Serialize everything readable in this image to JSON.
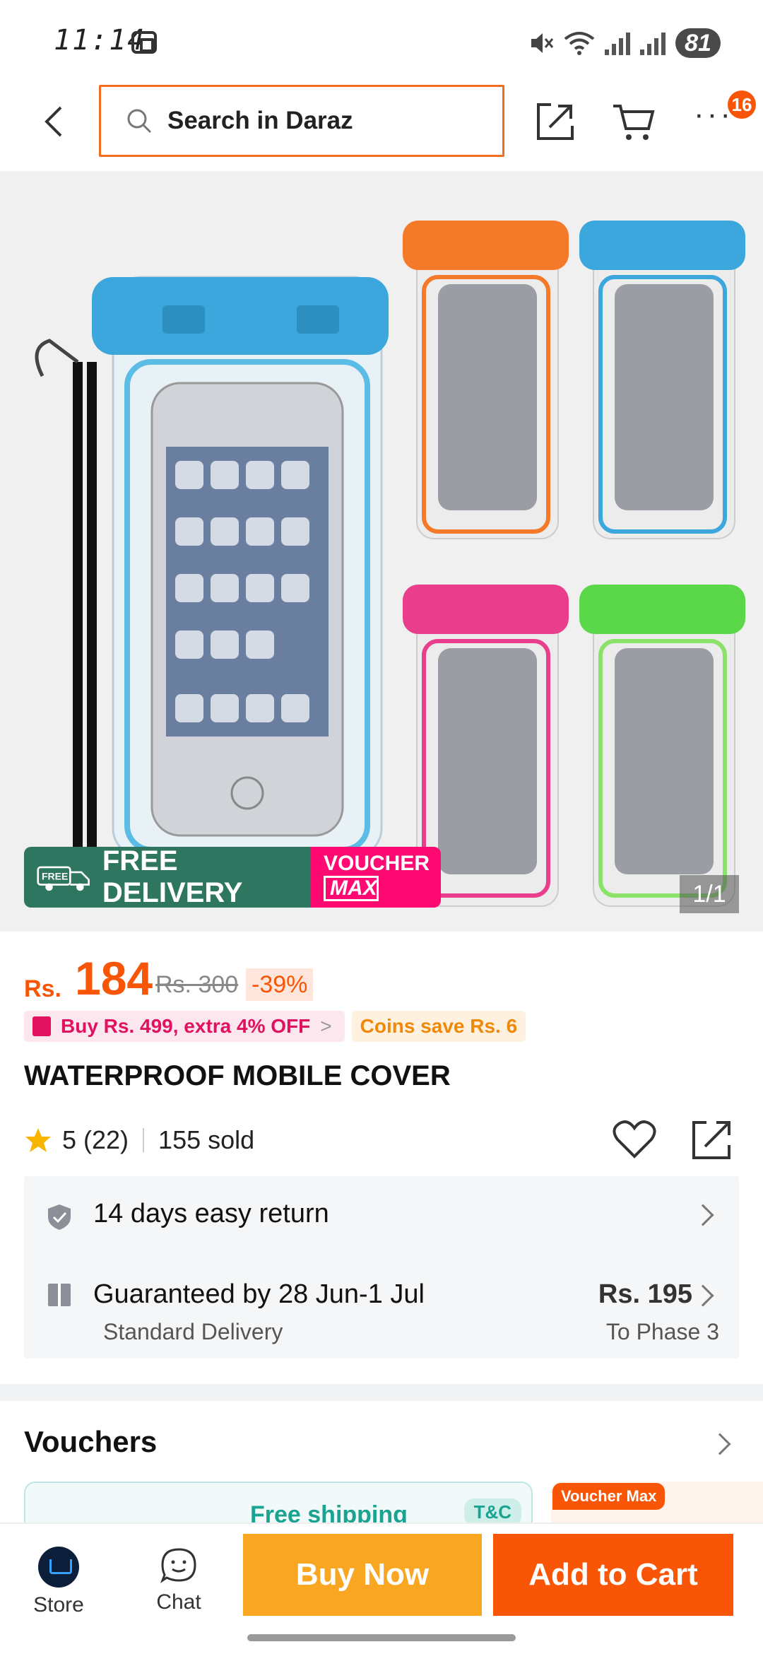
{
  "status_bar": {
    "time": "11:14",
    "battery": "81"
  },
  "header": {
    "search_placeholder": "Search in Daraz",
    "notification_count": "16"
  },
  "gallery": {
    "promo_free_delivery": "FREE DELIVERY",
    "promo_free_badge": "FREE",
    "promo_voucher": "VOUCHER",
    "promo_max": "MAX",
    "counter": "1/1"
  },
  "product": {
    "currency": "Rs.",
    "price": "184",
    "original_price": "Rs. 300",
    "discount": "-39%",
    "promo_deal": "Buy Rs. 499, extra 4% OFF",
    "coins": "Coins save Rs. 6",
    "title": "WATERPROOF MOBILE COVER",
    "rating": "5 (22)",
    "sold": "155 sold"
  },
  "service": {
    "return_text": "14 days easy return",
    "delivery_title": "Guaranteed by 28 Jun-1 Jul",
    "delivery_type": "Standard Delivery",
    "delivery_fee": "Rs. 195",
    "delivery_location": "To Phase 3"
  },
  "vouchers": {
    "heading": "Vouchers",
    "card1_title": "Free shipping",
    "card1_tag": "T&C",
    "card2_tag": "Voucher Max"
  },
  "bottom_bar": {
    "store_label": "Store",
    "chat_label": "Chat",
    "buy_now": "Buy Now",
    "add_to_cart": "Add to Cart"
  },
  "colors": {
    "brand_orange": "#f85606",
    "buy_now_yellow": "#f9a623",
    "free_delivery_green": "#2e7660",
    "voucher_pink": "#ff0a72"
  }
}
